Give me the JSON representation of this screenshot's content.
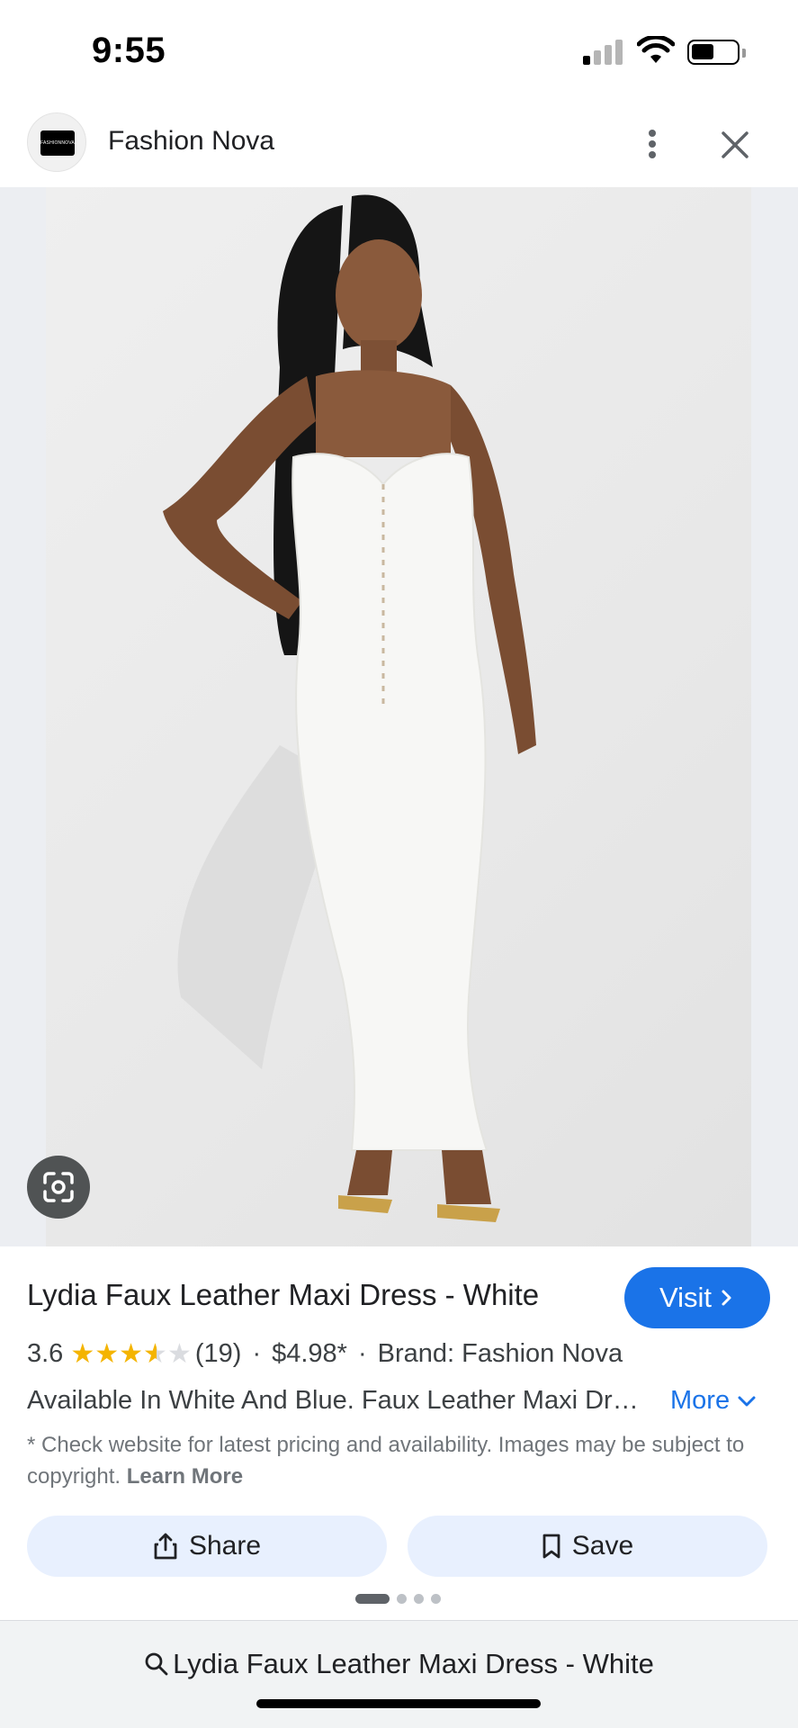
{
  "status_bar": {
    "time": "9:55"
  },
  "header": {
    "site_name": "Fashion Nova",
    "logo_text": "FASHIONNOVA"
  },
  "product": {
    "title": "Lydia Faux Leather Maxi Dress - White",
    "visit_label": "Visit",
    "rating_value": "3.6",
    "rating": 3.6,
    "review_count": "(19)",
    "price": "$4.98*",
    "brand": "Brand: Fashion Nova",
    "separator": "·",
    "description": "Available In White And Blue. Faux Leather Maxi Dress Adjustable Spaghetti Straps",
    "more_label": "More",
    "disclaimer": "* Check website for latest pricing and availability. Images may be subject to copyright.",
    "learn_more": "Learn More"
  },
  "actions": {
    "share_label": "Share",
    "save_label": "Save"
  },
  "carousel": {
    "total": 4,
    "active": 1
  },
  "search": {
    "query": "Lydia Faux Leather Maxi Dress - White"
  },
  "colors": {
    "accent": "#1a73e8",
    "chip_bg": "#e8f0fe",
    "star": "#f4b400"
  }
}
